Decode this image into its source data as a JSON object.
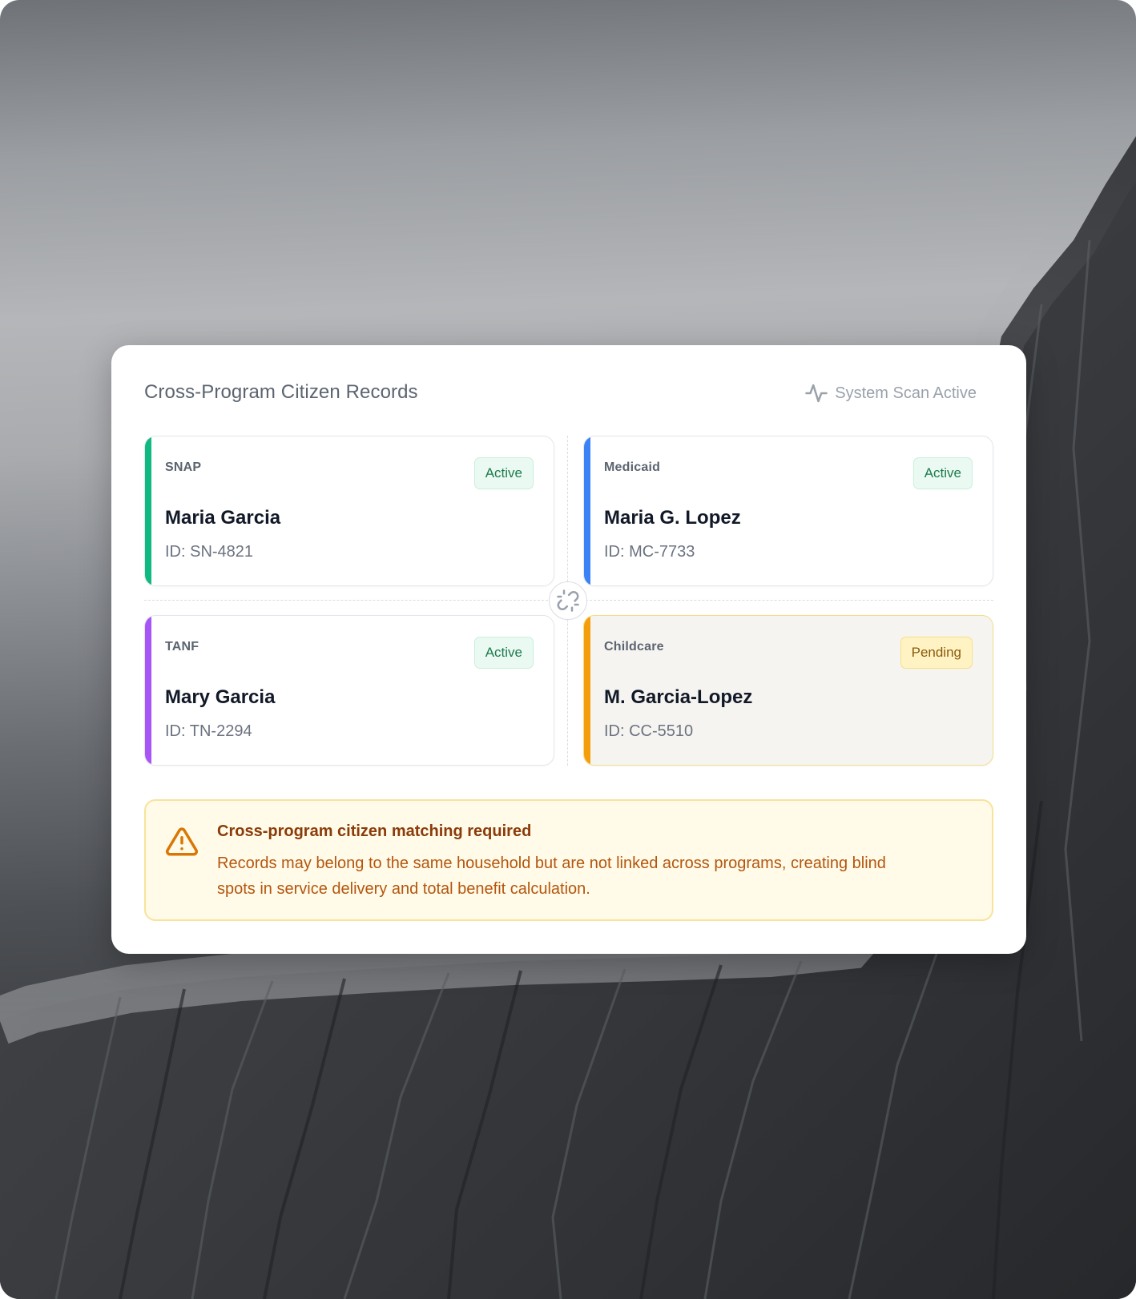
{
  "panel": {
    "title": "Cross-Program Citizen Records",
    "scan_status": "System Scan Active",
    "scan_icon": "activity-pulse-icon",
    "link_icon": "unlink-icon"
  },
  "records": [
    {
      "program": "SNAP",
      "name": "Maria Garcia",
      "id_text": "ID: SN-4821",
      "status": "Active",
      "accent_color": "#10b981"
    },
    {
      "program": "Medicaid",
      "name": "Maria G. Lopez",
      "id_text": "ID: MC-7733",
      "status": "Active",
      "accent_color": "#3b82f6"
    },
    {
      "program": "TANF",
      "name": "Mary Garcia",
      "id_text": "ID: TN-2294",
      "status": "Active",
      "accent_color": "#a855f7"
    },
    {
      "program": "Childcare",
      "name": "M. Garcia-Lopez",
      "id_text": "ID: CC-5510",
      "status": "Pending",
      "accent_color": "#f59e0b"
    }
  ],
  "alert": {
    "icon": "warning-triangle-icon",
    "title": "Cross-program citizen matching required",
    "body": "Records may belong to the same household but are not linked across programs, creating blind spots in service delivery and total benefit calculation.",
    "color": "#d97706"
  },
  "colors": {
    "status_active_text": "#1f7a4e",
    "status_pending_text": "#8a5a0b",
    "alert_background": "#fffbe8"
  }
}
